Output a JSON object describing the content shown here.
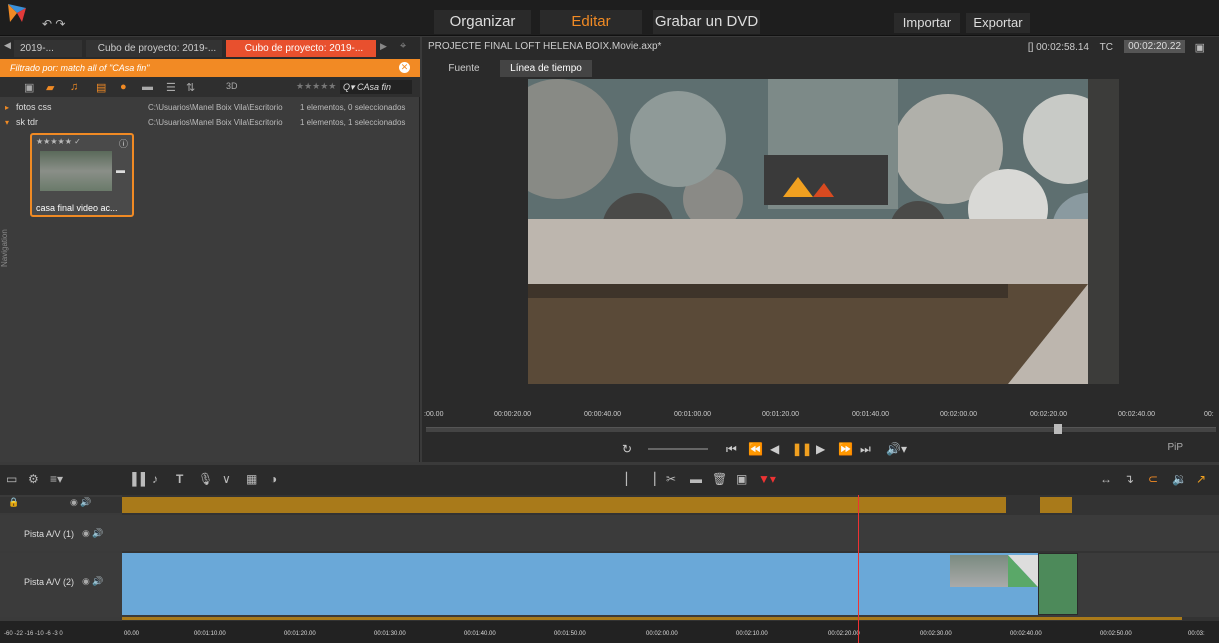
{
  "topbar": {
    "modes": [
      "Organizar",
      "Editar",
      "Grabar un DVD"
    ],
    "import": "Importar",
    "export": "Exportar"
  },
  "library": {
    "tabs": [
      "2019-...",
      "Cubo de proyecto: 2019-...",
      "Cubo de proyecto: 2019-..."
    ],
    "filter": "Filtrado por:   match all of \"CAsa fin\"",
    "search": "Q▾ CAsa fin",
    "stars": "★★★★★",
    "folders": [
      {
        "name": "fotos css",
        "path": "C:\\Usuarios\\Manel Boix Vila\\Escritorio",
        "count": "1 elementos, 0 seleccionados"
      },
      {
        "name": "sk tdr",
        "path": "C:\\Usuarios\\Manel Boix Vila\\Escritorio",
        "count": "1 elementos, 1 seleccionados"
      }
    ],
    "clip": {
      "stars": "★★★★★ ✓",
      "label": "casa final video ac..."
    },
    "nav_label": "Navigation"
  },
  "player": {
    "title": "PROJECTE FINAL LOFT HELENA BOIX.Movie.axp*",
    "duration": "[] 00:02:58.14",
    "tc_label": "TC",
    "timecode": "00:02:20.22",
    "tabs": [
      "Fuente",
      "Línea de tiempo"
    ],
    "ruler": [
      ":00.00",
      "00:00:20.00",
      "00:00:40.00",
      "00:01:00.00",
      "00:01:20.00",
      "00:01:40.00",
      "00:02:00.00",
      "00:02:20.00",
      "00:02:40.00",
      "00:"
    ],
    "pip": "PiP"
  },
  "timeline": {
    "tracks": [
      "Pista A/V (1)",
      "Pista A/V (2)"
    ],
    "ruler": [
      "00.00",
      "00:01:10.00",
      "00:01:20.00",
      "00:01:30.00",
      "00:01:40.00",
      "00:01:50.00",
      "00:02:00.00",
      "00:02:10.00",
      "00:02:20.00",
      "00:02:30.00",
      "00:02:40.00",
      "00:02:50.00",
      "00:03:"
    ],
    "meter": "-60  -22 -16  -10  -6  -3  0"
  }
}
